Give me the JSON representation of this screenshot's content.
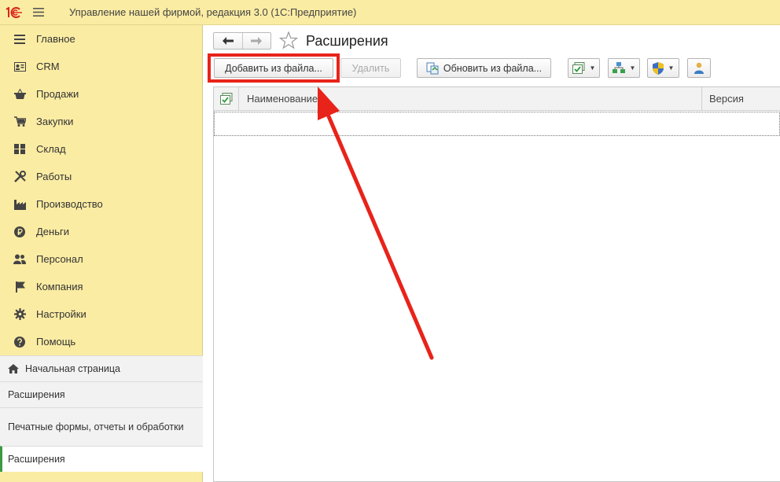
{
  "app": {
    "title": "Управление нашей фирмой, редакция 3.0  (1С:Предприятие)",
    "logo_text": "1С"
  },
  "sidebar": {
    "items": [
      {
        "label": "Главное",
        "icon": "menu-lines-icon"
      },
      {
        "label": "CRM",
        "icon": "contact-card-icon"
      },
      {
        "label": "Продажи",
        "icon": "basket-icon"
      },
      {
        "label": "Закупки",
        "icon": "cart-icon"
      },
      {
        "label": "Склад",
        "icon": "warehouse-grid-icon"
      },
      {
        "label": "Работы",
        "icon": "tools-icon"
      },
      {
        "label": "Производство",
        "icon": "factory-icon"
      },
      {
        "label": "Деньги",
        "icon": "ruble-icon"
      },
      {
        "label": "Персонал",
        "icon": "people-icon"
      },
      {
        "label": "Компания",
        "icon": "flag-icon"
      },
      {
        "label": "Настройки",
        "icon": "gear-icon"
      },
      {
        "label": "Помощь",
        "icon": "help-icon"
      }
    ],
    "open_pages": {
      "home": "Начальная страница",
      "items": [
        "Расширения",
        "Печатные формы, отчеты и обработки"
      ],
      "active": "Расширения"
    }
  },
  "main": {
    "title": "Расширения",
    "toolbar": {
      "add_from_file": "Добавить из файла...",
      "delete": "Удалить",
      "update_from_file": "Обновить из файла..."
    },
    "table": {
      "columns": [
        "Наименование",
        "Версия"
      ]
    }
  },
  "colors": {
    "sidebar_bg": "#fbeca3",
    "highlight": "#e8231a",
    "active_marker": "#3c9a44"
  }
}
